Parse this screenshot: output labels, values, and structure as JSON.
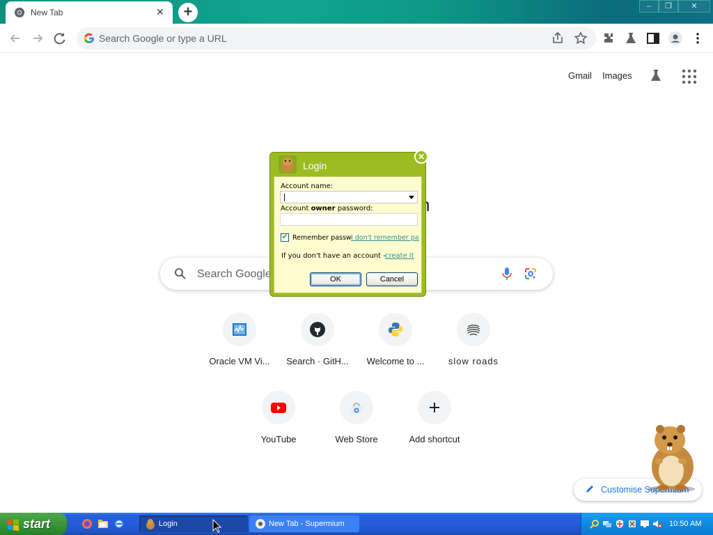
{
  "browser": {
    "tab_title": "New Tab",
    "omnibox_placeholder": "Search Google or type a URL"
  },
  "ntp": {
    "gmail": "Gmail",
    "images": "Images",
    "logo_fragment": "n",
    "search_placeholder": "Search Google",
    "shortcuts": [
      {
        "label": "Oracle VM Vi...",
        "icon": "virtualbox-icon"
      },
      {
        "label": "Search · GitH...",
        "icon": "github-icon"
      },
      {
        "label": "Welcome to ...",
        "icon": "python-icon"
      },
      {
        "label": "slow roads",
        "icon": "slow-roads-icon"
      },
      {
        "label": "YouTube",
        "icon": "youtube-icon"
      },
      {
        "label": "Web Store",
        "icon": "web-store-icon"
      },
      {
        "label": "Add shortcut",
        "icon": "plus-icon"
      }
    ],
    "customise": "Customise Supermium"
  },
  "login_dialog": {
    "title": "Login",
    "account_name_label": "Account name:",
    "account_owner_label_prefix": "Account ",
    "account_owner_label_bold": "owner",
    "account_owner_label_suffix": " password:",
    "remember_label": "Remember passw",
    "remember_checked": true,
    "forgot_link": "I don't remember pas",
    "no_account_text": "If you don't have an account - ",
    "create_link": "create it",
    "ok_label": "OK",
    "cancel_label": "Cancel"
  },
  "taskbar": {
    "start_label": "start",
    "tasks": [
      {
        "label": "Login"
      },
      {
        "label": "New Tab - Supermium"
      }
    ],
    "clock": "10:50 AM"
  },
  "colors": {
    "titlebar_teal": "#11a58f",
    "dialog_green": "#9cbc22",
    "dialog_body": "#fffdcf",
    "xp_blue": "#245edb",
    "start_green": "#3c9a3c",
    "link_blue": "#1a73e8"
  }
}
